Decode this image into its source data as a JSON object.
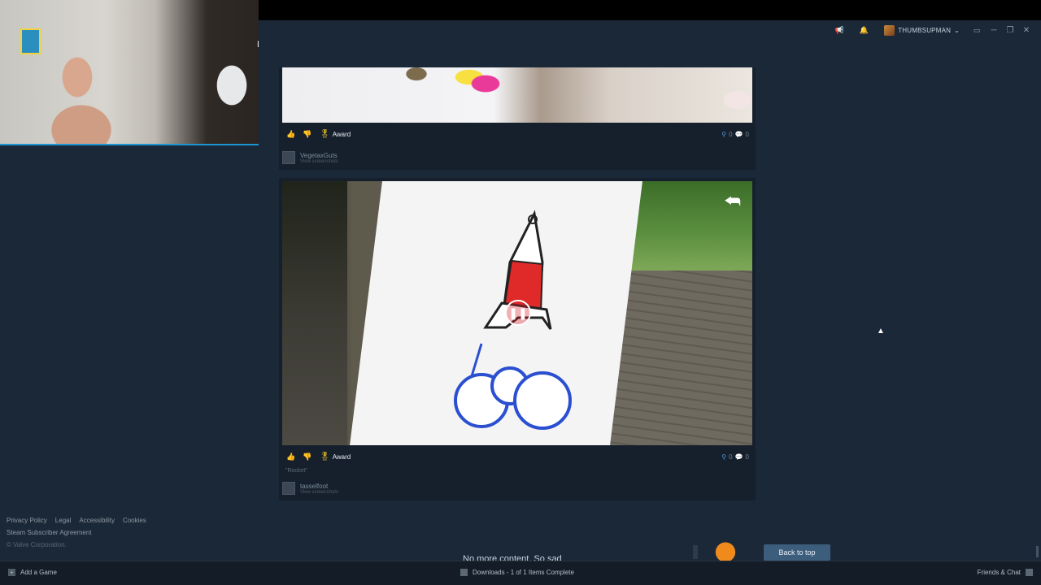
{
  "webcam": {
    "label": "N"
  },
  "titlebar": {
    "announce_icon": "megaphone-icon",
    "bell_icon": "bell-icon",
    "username": "THUMBSUPMAN",
    "chevron": "⌄",
    "window_controls": {
      "monitor": "▭",
      "minimize": "─",
      "maximize": "❐",
      "close": "✕"
    }
  },
  "feed": {
    "items": [
      {
        "award_label": "Award",
        "likes_count": "0",
        "comments_count": "0",
        "author": "VegetaxGuts",
        "author_sub": "View screenshots"
      },
      {
        "award_label": "Award",
        "likes_count": "0",
        "comments_count": "0",
        "caption": "\"Rocket\"",
        "author": "tasselfoot",
        "author_sub": "View screenshots"
      }
    ],
    "no_more": "No more content. So sad",
    "back_to_top": "Back to top"
  },
  "footer": {
    "links": [
      "Privacy Policy",
      "Legal",
      "Accessibility",
      "Cookies"
    ],
    "agreement": "Steam Subscriber Agreement",
    "copyright": "© Valve Corporation."
  },
  "bottombar": {
    "add_game": "Add a Game",
    "downloads": "Downloads - 1 of 1 Items Complete",
    "friends": "Friends & Chat"
  },
  "colors": {
    "background": "#1b2838",
    "accent_button": "#3d5d7c",
    "award_gold": "#f0c630"
  }
}
